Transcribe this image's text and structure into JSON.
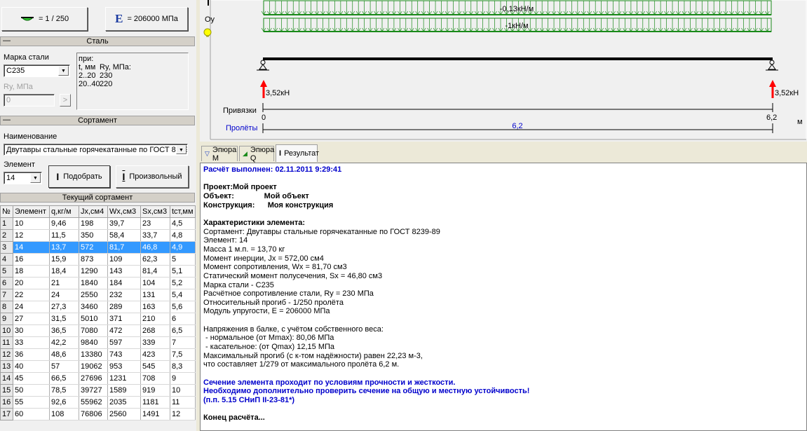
{
  "left": {
    "deflection_button": "= 1 / 250",
    "modulus_button": "= 206000 МПа",
    "modulus_icon_letter": "E",
    "steel_section": {
      "title": "Сталь",
      "collapse": "—",
      "grade_label": "Марка стали",
      "grade_value": "С235",
      "ry_label": "Ry, МПа",
      "ry_value": "0",
      "ry_button": ">",
      "info": {
        "line1": "при:",
        "col_t": "t, мм",
        "col_ry": "Ry, МПа:",
        "rows": [
          [
            "2..20",
            "230"
          ],
          [
            "20..40",
            "220"
          ]
        ]
      }
    },
    "assortment_section": {
      "title": "Сортамент",
      "collapse": "—",
      "name_label": "Наименование",
      "name_value": "Двутавры стальные горячекатанные по ГОСТ 8239-89",
      "element_label": "Элемент",
      "element_value": "14",
      "pick_button": "Подобрать",
      "custom_button": "Произвольный"
    },
    "current_title": "Текущий сортамент",
    "table": {
      "headers": [
        "№",
        "Элемент",
        "q,кг/м",
        "Jx,см4",
        "Wx,см3",
        "Sx,см3",
        "tст,мм"
      ],
      "selected_row": 3,
      "rows": [
        [
          "1",
          "10",
          "9,46",
          "198",
          "39,7",
          "23",
          "4,5"
        ],
        [
          "2",
          "12",
          "11,5",
          "350",
          "58,4",
          "33,7",
          "4,8"
        ],
        [
          "3",
          "14",
          "13,7",
          "572",
          "81,7",
          "46,8",
          "4,9"
        ],
        [
          "4",
          "16",
          "15,9",
          "873",
          "109",
          "62,3",
          "5"
        ],
        [
          "5",
          "18",
          "18,4",
          "1290",
          "143",
          "81,4",
          "5,1"
        ],
        [
          "6",
          "20",
          "21",
          "1840",
          "184",
          "104",
          "5,2"
        ],
        [
          "7",
          "22",
          "24",
          "2550",
          "232",
          "131",
          "5,4"
        ],
        [
          "8",
          "24",
          "27,3",
          "3460",
          "289",
          "163",
          "5,6"
        ],
        [
          "9",
          "27",
          "31,5",
          "5010",
          "371",
          "210",
          "6"
        ],
        [
          "10",
          "30",
          "36,5",
          "7080",
          "472",
          "268",
          "6,5"
        ],
        [
          "11",
          "33",
          "42,2",
          "9840",
          "597",
          "339",
          "7"
        ],
        [
          "12",
          "36",
          "48,6",
          "13380",
          "743",
          "423",
          "7,5"
        ],
        [
          "13",
          "40",
          "57",
          "19062",
          "953",
          "545",
          "8,3"
        ],
        [
          "14",
          "45",
          "66,5",
          "27696",
          "1231",
          "708",
          "9"
        ],
        [
          "15",
          "50",
          "78,5",
          "39727",
          "1589",
          "919",
          "10"
        ],
        [
          "16",
          "55",
          "92,6",
          "55962",
          "2035",
          "1181",
          "11"
        ],
        [
          "17",
          "60",
          "108",
          "76806",
          "2560",
          "1491",
          "12"
        ]
      ]
    }
  },
  "diagram": {
    "axis_label": "Oy",
    "load1": "-0,13кН/м",
    "load2": "-1кН/м",
    "reaction_left": "3,52кН",
    "reaction_right": "3,52кН",
    "bindings_label": "Привязки",
    "bind_start": "0",
    "bind_end": "6,2",
    "spans_label": "Пролёты",
    "span_value": "6,2",
    "unit": "м",
    "load_color": "#1a8a1a",
    "reaction_color": "#ff0000"
  },
  "tabs": [
    {
      "label": "Эпюра M",
      "icon": "moment-diagram-icon"
    },
    {
      "label": "Эпюра Q",
      "icon": "shear-diagram-icon"
    },
    {
      "label": "Результат",
      "icon": "i-beam-icon",
      "active": true
    }
  ],
  "result": {
    "lines": [
      {
        "t": "Расчёт выполнен: 02.11.2011 9:29:41",
        "s": "blue"
      },
      {
        "t": "",
        "s": ""
      },
      {
        "t": "Проект:Мой проект",
        "s": "b"
      },
      {
        "t": "Объект:              Мой объект",
        "s": "b"
      },
      {
        "t": "Конструкция:      Моя конструкция",
        "s": "b"
      },
      {
        "t": "",
        "s": ""
      },
      {
        "t": "Характеристики элемента:",
        "s": "b"
      },
      {
        "t": "Сортамент: Двутавры стальные горячекатанные по ГОСТ 8239-89",
        "s": ""
      },
      {
        "t": "Элемент: 14",
        "s": ""
      },
      {
        "t": "Масса 1 м.п. = 13,70 кг",
        "s": ""
      },
      {
        "t": "Момент инерции, Jx = 572,00 см4",
        "s": ""
      },
      {
        "t": "Момент сопротивления, Wx = 81,70 см3",
        "s": ""
      },
      {
        "t": "Статический момент полусечения, Sx = 46,80 см3",
        "s": ""
      },
      {
        "t": "Марка стали - С235",
        "s": ""
      },
      {
        "t": "Расчётное сопротивление стали, Ry = 230 МПа",
        "s": ""
      },
      {
        "t": "Относительный прогиб - 1/250 пролёта",
        "s": ""
      },
      {
        "t": "Модуль упругости, E = 206000 МПа",
        "s": ""
      },
      {
        "t": "",
        "s": ""
      },
      {
        "t": "Напряжения в балке, с учётом собственного веса:",
        "s": ""
      },
      {
        "t": " - нормальное (от Mmax): 80,06 МПа",
        "s": ""
      },
      {
        "t": " - касательное: (от Qmax) 12,15 МПа",
        "s": ""
      },
      {
        "t": "Максимальный прогиб (с к-том надёжности) равен 22,23 м-3,",
        "s": ""
      },
      {
        "t": "что составляет 1/279 от максимального пролёта 6,2 м.",
        "s": ""
      },
      {
        "t": "",
        "s": ""
      },
      {
        "t": "Сечение элемента проходит по условиям прочности и жесткости.",
        "s": "blue"
      },
      {
        "t": "Необходимо дополнительно проверить сечение на общую и местную устойчивость!",
        "s": "blue"
      },
      {
        "t": "(п.п. 5.15 СНиП II-23-81*)",
        "s": "blue"
      },
      {
        "t": "",
        "s": ""
      },
      {
        "t": "Конец расчёта...",
        "s": "b"
      }
    ]
  }
}
